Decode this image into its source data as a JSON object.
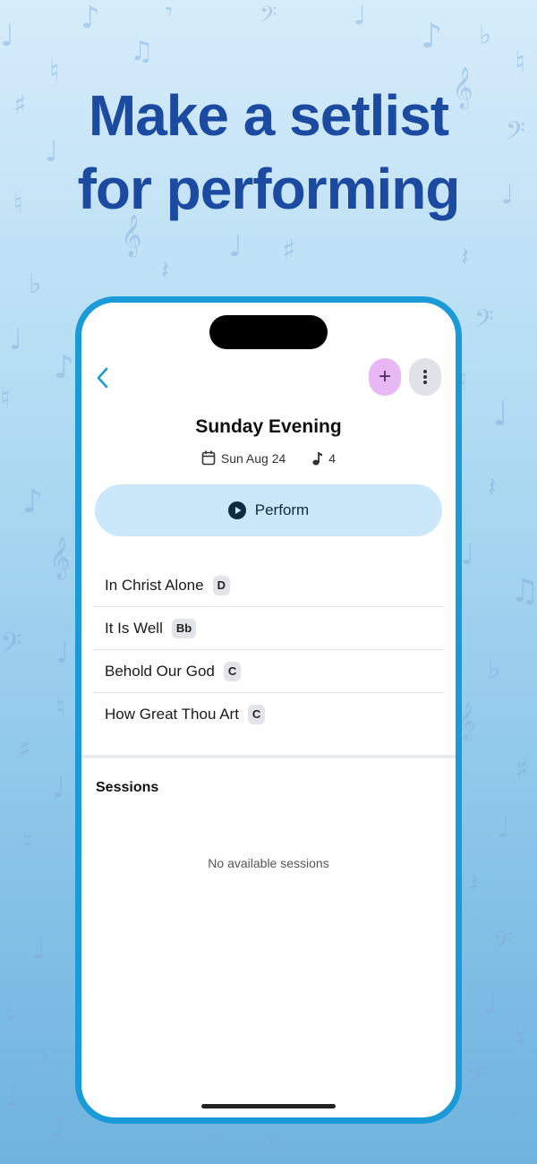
{
  "headline": {
    "line1": "Make a setlist",
    "line2": "for performing"
  },
  "phone": {
    "nav": {
      "back_icon": "chevron-left-icon",
      "add_label": "+",
      "more_icon": "ellipsis-vertical-icon"
    },
    "setlist": {
      "title": "Sunday Evening",
      "date": "Sun Aug 24",
      "song_count": "4"
    },
    "perform_label": "Perform",
    "songs": [
      {
        "title": "In Christ Alone",
        "key": "D"
      },
      {
        "title": "It Is Well",
        "key": "Bb"
      },
      {
        "title": "Behold Our God",
        "key": "C"
      },
      {
        "title": "How Great Thou Art",
        "key": "C"
      }
    ],
    "sessions": {
      "heading": "Sessions",
      "empty_text": "No available sessions"
    }
  },
  "colors": {
    "headline": "#1b4aa0",
    "phone_border": "#1a9ad7",
    "add_button": "#e7b8f3",
    "perform_button": "#cbe8fb"
  }
}
